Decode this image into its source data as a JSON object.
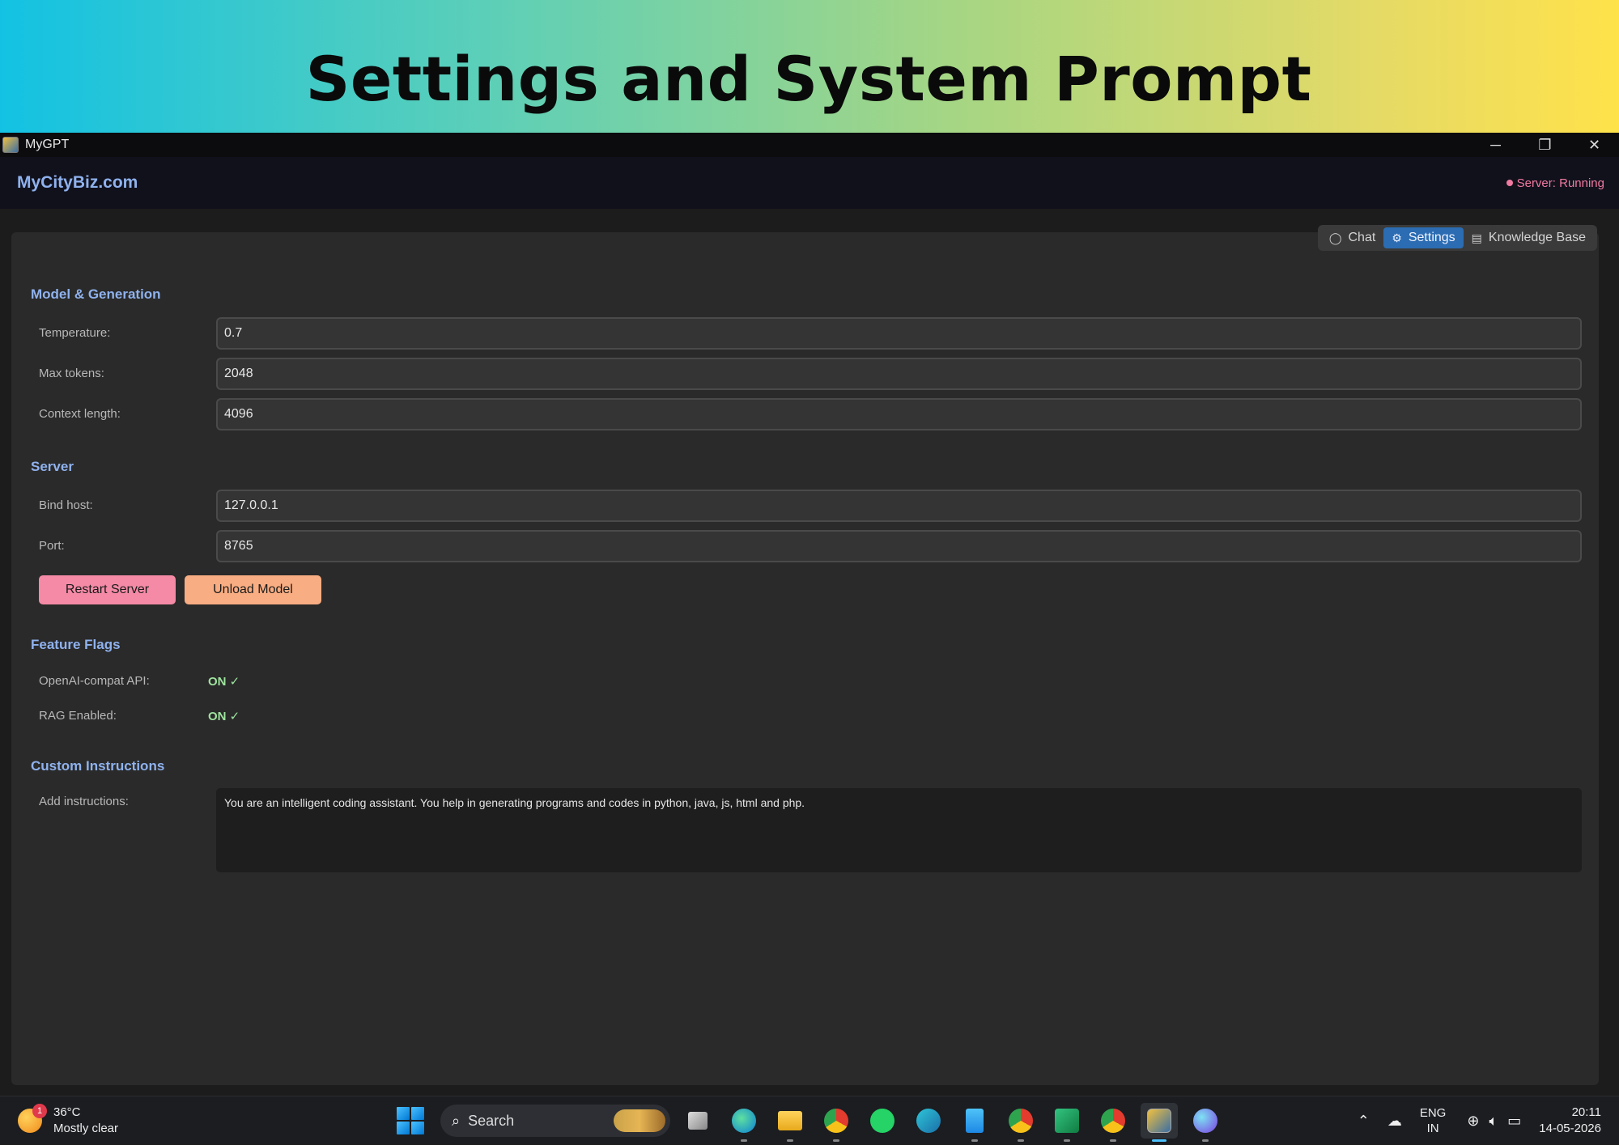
{
  "banner": {
    "title": "Settings and System Prompt"
  },
  "window": {
    "title": "MyGPT",
    "controls": {
      "minimize": "─",
      "restore": "❐",
      "close": "✕"
    }
  },
  "header": {
    "brand": "MyCityBiz.com",
    "server_status": "Server: Running",
    "status_color": "#f07aa0"
  },
  "tabs": [
    {
      "label": "Chat",
      "icon": "chat-bubble-icon",
      "active": false
    },
    {
      "label": "Settings",
      "icon": "gear-icon",
      "active": true
    },
    {
      "label": "Knowledge Base",
      "icon": "database-icon",
      "active": false
    }
  ],
  "sections": {
    "model": {
      "title": "Model & Generation",
      "temperature": {
        "label": "Temperature:",
        "value": "0.7"
      },
      "max_tokens": {
        "label": "Max tokens:",
        "value": "2048"
      },
      "context_length": {
        "label": "Context length:",
        "value": "4096"
      }
    },
    "server": {
      "title": "Server",
      "bind_host": {
        "label": "Bind host:",
        "value": "127.0.0.1"
      },
      "port": {
        "label": "Port:",
        "value": "8765"
      },
      "restart_label": "Restart Server",
      "unload_label": "Unload Model"
    },
    "flags": {
      "title": "Feature Flags",
      "openai_api": {
        "label": "OpenAI-compat API:",
        "value": "ON ✓"
      },
      "rag": {
        "label": "RAG Enabled:",
        "value": "ON ✓"
      }
    },
    "custom": {
      "title": "Custom Instructions",
      "label": "Add instructions:",
      "value": "You are an intelligent coding assistant. You help in generating programs and codes in python, java, js, html and php."
    }
  },
  "colors": {
    "accent": "#8fb2ee",
    "tab_active": "#2b6cb3",
    "restart_button": "#f48aa6",
    "unload_button": "#f9ad82",
    "flag_on": "#9ee39e"
  },
  "taskbar": {
    "weather": {
      "temp": "36°C",
      "desc": "Mostly clear",
      "badge": "1"
    },
    "search_label": "Search",
    "lang": {
      "line1": "ENG",
      "line2": "IN"
    },
    "clock": {
      "time": "20:11",
      "date": "14-05-2026"
    }
  }
}
